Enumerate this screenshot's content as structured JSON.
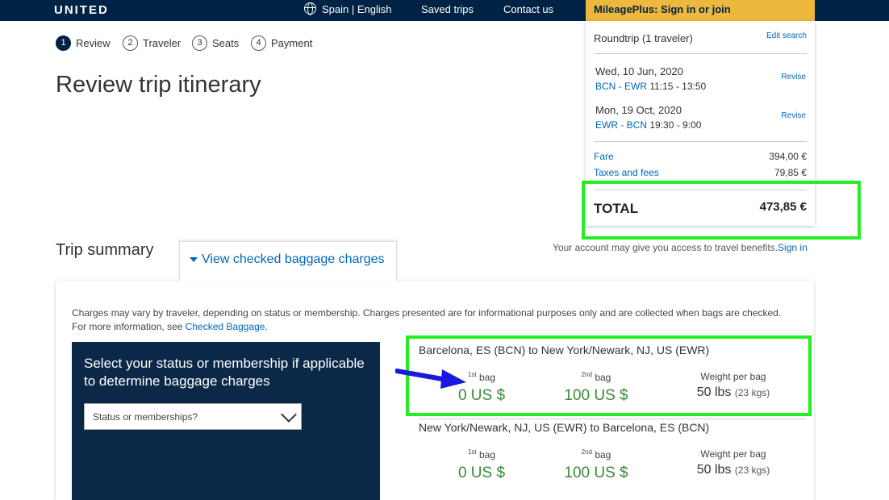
{
  "header": {
    "logo": "UNITED",
    "locale": "Spain | English",
    "saved_trips": "Saved trips",
    "contact_us": "Contact us",
    "mileageplus": "MileagePlus: Sign in or join"
  },
  "steps": [
    {
      "num": "1",
      "label": "Review"
    },
    {
      "num": "2",
      "label": "Traveler"
    },
    {
      "num": "3",
      "label": "Seats"
    },
    {
      "num": "4",
      "label": "Payment"
    }
  ],
  "page_title": "Review trip itinerary",
  "summary": {
    "trip_type": "Roundtrip (1 traveler)",
    "edit_search": "Edit search",
    "legs": [
      {
        "date": "Wed, 10 Jun, 2020",
        "codes": "BCN - EWR",
        "times": "11:15 - 13:50",
        "revise": "Revise"
      },
      {
        "date": "Mon, 19 Oct, 2020",
        "codes": "EWR - BCN",
        "times": "19:30 - 9:00",
        "revise": "Revise"
      }
    ],
    "fare_label": "Fare",
    "fare_value": "394,00 €",
    "taxes_label": "Taxes and fees",
    "taxes_value": "79,85 €",
    "total_label": "TOTAL",
    "total_value": "473,85 €"
  },
  "benefits": {
    "text": "Your account may give you access to travel benefits.",
    "link": "Sign in"
  },
  "trip_summary": "Trip summary",
  "baggage_tab": "View checked baggage charges",
  "baggage": {
    "notice": "Charges may vary by traveler, depending on status or membership. Charges presented are for informational purposes only and are collected when bags are checked. For more information, see ",
    "notice_link": "Checked Baggage",
    "notice_end": ".",
    "status_heading": "Select your status or membership if applicable to determine baggage charges",
    "status_placeholder": "Status or memberships?",
    "routes": [
      {
        "route": "Barcelona, ES (BCN) to New York/Newark, NJ, US (EWR)",
        "bag1_label": "bag",
        "bag1_sup": "1st",
        "bag1_value": "0 US $",
        "bag2_label": "bag",
        "bag2_sup": "2nd",
        "bag2_value": "100 US $",
        "weight_label": "Weight per bag",
        "weight_value": "50 lbs",
        "weight_kg": "(23 kgs)"
      },
      {
        "route": "New York/Newark, NJ, US (EWR) to Barcelona, ES (BCN)",
        "bag1_label": "bag",
        "bag1_sup": "1st",
        "bag1_value": "0 US $",
        "bag2_label": "bag",
        "bag2_sup": "2nd",
        "bag2_value": "100 US $",
        "weight_label": "Weight per bag",
        "weight_value": "50 lbs",
        "weight_kg": "(23 kgs)"
      }
    ]
  },
  "colors": {
    "navy": "#002244",
    "gold": "#edb83d",
    "link": "#0067b8",
    "highlight": "#22ee22",
    "price_green": "#3a8a3a",
    "arrow": "#1a1adf"
  }
}
